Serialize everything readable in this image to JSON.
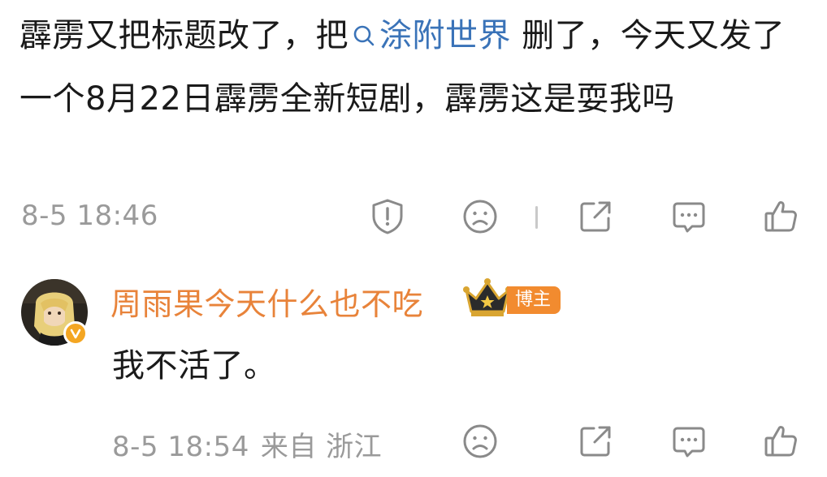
{
  "post": {
    "text_part1": "霹雳又把标题改了，把",
    "topic": "涂附世界",
    "text_part2": " 删了，今天又发了一个8月22日霹雳全新短剧，霹雳这是耍我吗"
  },
  "post_actions": {
    "timestamp": "8-5 18:46",
    "icons": [
      "report-icon",
      "dislike-icon",
      "share-icon",
      "comment-icon",
      "like-icon"
    ]
  },
  "reply": {
    "username": "周雨果今天什么也不吃",
    "badge_label": "博主",
    "text": "我不活了。",
    "timestamp": "8-5 18:54",
    "location": "来自 浙江"
  },
  "colors": {
    "text": "#1a1a1a",
    "muted": "#9a9a9a",
    "link": "#3a73b8",
    "username": "#e8833a",
    "badge_bg": "#f28b2f",
    "icon": "#8a8a8a"
  }
}
